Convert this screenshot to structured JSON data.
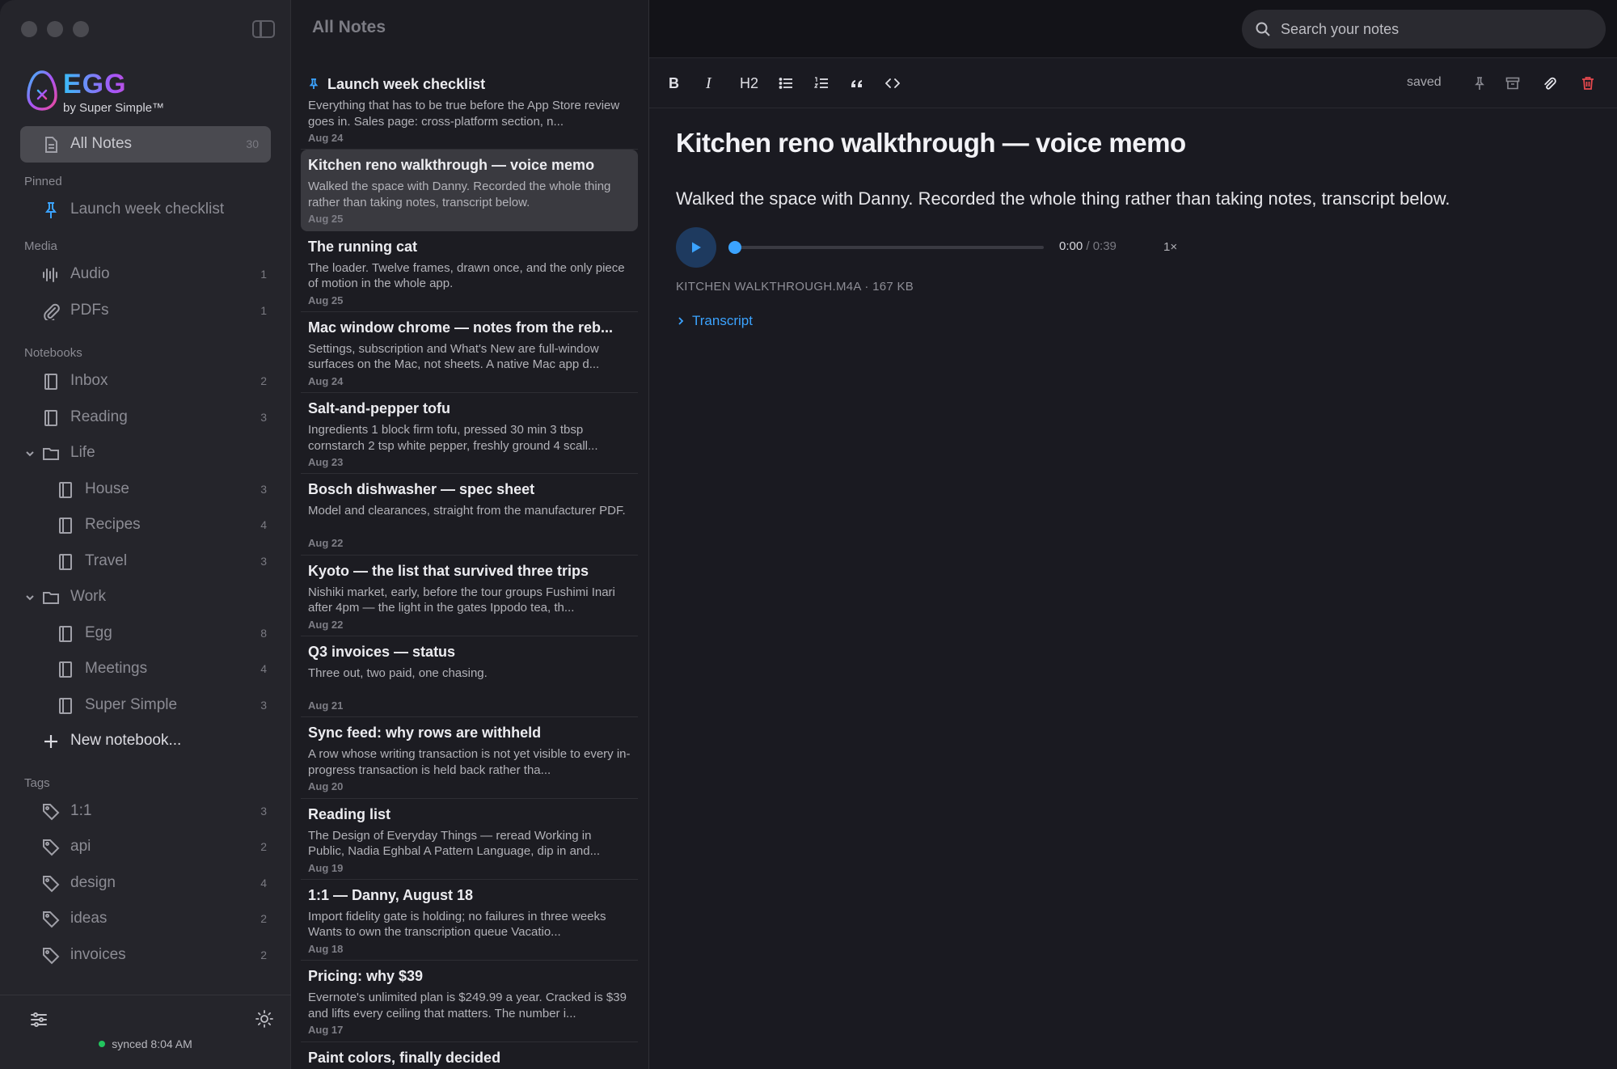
{
  "sidebar": {
    "brand": "EGG",
    "brand_sub": "by Super Simple™",
    "all_notes": {
      "label": "All Notes",
      "count": "30"
    },
    "pinned_title": "Pinned",
    "pinned": [
      {
        "label": "Launch week checklist"
      }
    ],
    "media_title": "Media",
    "media": [
      {
        "label": "Audio",
        "count": "1"
      },
      {
        "label": "PDFs",
        "count": "1"
      }
    ],
    "notebooks_title": "Notebooks",
    "notebooks": [
      {
        "label": "Inbox",
        "count": "2"
      },
      {
        "label": "Reading",
        "count": "3"
      },
      {
        "label": "Life",
        "folder": true
      },
      {
        "label": "House",
        "count": "3"
      },
      {
        "label": "Recipes",
        "count": "4"
      },
      {
        "label": "Travel",
        "count": "3"
      },
      {
        "label": "Work",
        "folder": true
      },
      {
        "label": "Egg",
        "count": "8"
      },
      {
        "label": "Meetings",
        "count": "4"
      },
      {
        "label": "Super Simple",
        "count": "3"
      }
    ],
    "new_notebook": "New notebook...",
    "tags_title": "Tags",
    "tags": [
      {
        "label": "1:1",
        "count": "3"
      },
      {
        "label": "api",
        "count": "2"
      },
      {
        "label": "design",
        "count": "4"
      },
      {
        "label": "ideas",
        "count": "2"
      },
      {
        "label": "invoices",
        "count": "2"
      }
    ],
    "sync_status": "synced 8:04 AM"
  },
  "list": {
    "title": "All Notes",
    "notes": [
      {
        "title": "Launch week checklist",
        "preview": "Everything that has to be true before the App Store review goes in. Sales page: cross-platform section, n...",
        "date": "Aug 24"
      },
      {
        "title": "Kitchen reno walkthrough — voice memo",
        "preview": "Walked the space with Danny. Recorded the whole thing rather than taking notes, transcript below.",
        "date": "Aug 25"
      },
      {
        "title": "The running cat",
        "preview": "The loader. Twelve frames, drawn once, and the only piece of motion in the whole app.",
        "date": "Aug 25"
      },
      {
        "title": "Mac window chrome — notes from the reb...",
        "preview": "Settings, subscription and What's New are full-window surfaces on the Mac, not sheets. A native Mac app d...",
        "date": "Aug 24"
      },
      {
        "title": "Salt-and-pepper tofu",
        "preview": "Ingredients 1 block firm tofu, pressed 30 min 3 tbsp cornstarch 2 tsp white pepper, freshly ground 4 scall...",
        "date": "Aug 23"
      },
      {
        "title": "Bosch dishwasher — spec sheet",
        "preview": "Model and clearances, straight from the manufacturer PDF.",
        "date": "Aug 22"
      },
      {
        "title": "Kyoto — the list that survived three trips",
        "preview": "Nishiki market, early, before the tour groups Fushimi Inari after 4pm — the light in the gates Ippodo tea, th...",
        "date": "Aug 22"
      },
      {
        "title": "Q3 invoices — status",
        "preview": "Three out, two paid, one chasing.",
        "date": "Aug 21"
      },
      {
        "title": "Sync feed: why rows are withheld",
        "preview": "A row whose writing transaction is not yet visible to every in-progress transaction is held back rather tha...",
        "date": "Aug 20"
      },
      {
        "title": "Reading list",
        "preview": "The Design of Everyday Things — reread Working in Public, Nadia Eghbal A Pattern Language, dip in and...",
        "date": "Aug 19"
      },
      {
        "title": "1:1 — Danny, August 18",
        "preview": "Import fidelity gate is holding; no failures in three weeks Wants to own the transcription queue Vacatio...",
        "date": "Aug 18"
      },
      {
        "title": "Pricing: why $39",
        "preview": "Evernote's unlimited plan is $249.99 a year. Cracked is $39 and lifts every ceiling that matters. The number i...",
        "date": "Aug 17"
      },
      {
        "title": "Paint colors, finally decided",
        "preview": "",
        "date": ""
      }
    ]
  },
  "header": {
    "search_placeholder": "Search your notes"
  },
  "toolbar": {
    "bold": "B",
    "italic": "I",
    "h2": "H2",
    "status": "saved"
  },
  "editor": {
    "title": "Kitchen reno walkthrough — voice memo",
    "body": "Walked the space with Danny. Recorded the whole thing rather than taking notes, transcript below.",
    "player": {
      "current": "0:00",
      "duration": " / 0:39",
      "speed": "1×",
      "progress": 0
    },
    "file_info": "KITCHEN WALKTHROUGH.M4A · 167 KB",
    "transcript_label": "Transcript"
  },
  "colors": {
    "accent": "#3ba3ff",
    "sync_dot": "#22c55e",
    "danger": "#e5484d"
  }
}
